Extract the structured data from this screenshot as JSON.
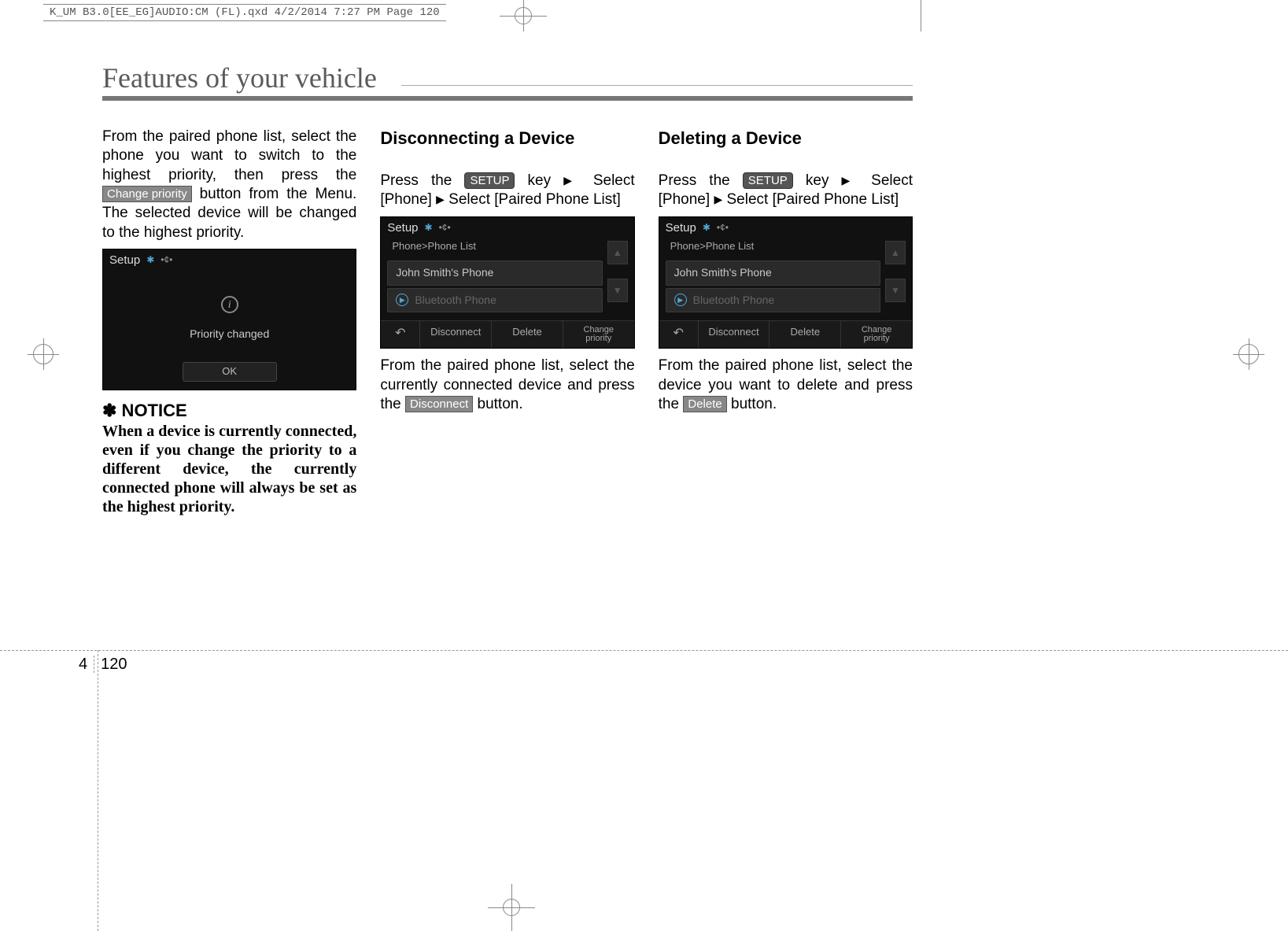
{
  "print_header": "K_UM B3.0[EE_EG]AUDIO:CM (FL).qxd  4/2/2014  7:27 PM  Page 120",
  "page_title": "Features of your vehicle",
  "page_number": {
    "section": "4",
    "page": "120"
  },
  "col1": {
    "para1_a": "From the paired phone list, select the phone you want to switch to the highest priority, then press the ",
    "btn_change_priority": "Change priority",
    "para1_b": " button from the Menu. The selected device will be changed to the highest priority.",
    "shot": {
      "title": "Setup",
      "info_glyph": "i",
      "msg": "Priority changed",
      "ok": "OK"
    },
    "notice_mark": "✽",
    "notice_label": " NOTICE",
    "notice_body": "When a device is currently connected, even if you change the priority to a different device, the currently connected phone will always be set as the highest priority."
  },
  "col2": {
    "heading": "Disconnecting a Device",
    "line1_a": "Press the ",
    "setup_key": "SETUP",
    "line1_b": " key",
    "line1_c": "Select [Phone]",
    "line1_d": "Select [Paired Phone List]",
    "shot": {
      "title": "Setup",
      "breadcrumb": "Phone>Phone List",
      "row1": "John Smith's Phone",
      "row2": "Bluetooth Phone",
      "back": "↶",
      "f_disc": "Disconnect",
      "f_del": "Delete",
      "f_chg1": "Change",
      "f_chg2": "priority"
    },
    "after_a": "From the paired phone list, select the currently connected device and press the ",
    "btn_disconnect": "Disconnect",
    "after_b": " button."
  },
  "col3": {
    "heading": "Deleting a Device",
    "line1_a": "Press the ",
    "setup_key": "SETUP",
    "line1_b": " key",
    "line1_c": "Select [Phone]",
    "line1_d": "Select [Paired Phone List]",
    "shot": {
      "title": "Setup",
      "breadcrumb": "Phone>Phone List",
      "row1": "John Smith's Phone",
      "row2": "Bluetooth Phone",
      "back": "↶",
      "f_disc": "Disconnect",
      "f_del": "Delete",
      "f_chg1": "Change",
      "f_chg2": "priority"
    },
    "after_a": "From the paired phone list, select the device you want to delete and press the ",
    "btn_delete": "Delete",
    "after_b": " button."
  },
  "glyphs": {
    "tri": "▶",
    "up": "▲",
    "down": "▼",
    "play": "▶"
  }
}
